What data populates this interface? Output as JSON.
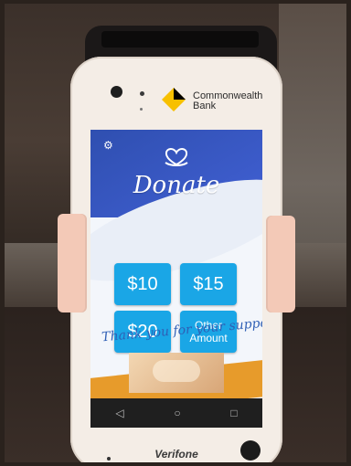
{
  "device": {
    "bank_name_line1": "Commonwealth",
    "bank_name_line2": "Bank",
    "brand": "Verifone"
  },
  "app": {
    "title": "Donate",
    "buttons": [
      {
        "label": "$10"
      },
      {
        "label": "$15"
      },
      {
        "label": "$20"
      },
      {
        "label_line1": "Other",
        "label_line2": "Amount"
      }
    ],
    "thank_you_message": "Thank you for your support",
    "icons": {
      "settings": "gear-icon",
      "logo": "heart-hands-icon",
      "back": "back-triangle-icon",
      "home": "home-circle-icon",
      "recent": "recent-square-icon"
    },
    "colors": {
      "primary_blue": "#3f5ed0",
      "button_blue": "#1aa6e6",
      "accent_orange": "#e79b2b",
      "cba_yellow": "#f7c000"
    }
  }
}
